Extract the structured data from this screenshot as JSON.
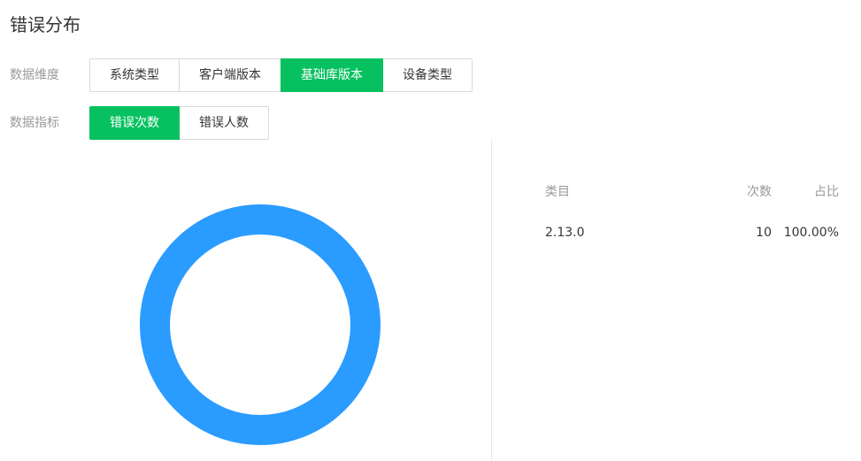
{
  "page": {
    "title": "错误分布"
  },
  "filters": {
    "dimension": {
      "label": "数据维度",
      "options": [
        {
          "label": "系统类型",
          "active": false
        },
        {
          "label": "客户端版本",
          "active": false
        },
        {
          "label": "基础库版本",
          "active": true
        },
        {
          "label": "设备类型",
          "active": false
        }
      ]
    },
    "metric": {
      "label": "数据指标",
      "options": [
        {
          "label": "错误次数",
          "active": true
        },
        {
          "label": "错误人数",
          "active": false
        }
      ]
    }
  },
  "colors": {
    "accent": "#07c160",
    "series": "#2a9bff"
  },
  "table": {
    "headers": {
      "category": "类目",
      "count": "次数",
      "ratio": "占比"
    },
    "rows": [
      {
        "category": "2.13.0",
        "count": "10",
        "ratio": "100.00%"
      }
    ]
  },
  "chart_data": {
    "type": "pie",
    "donut": true,
    "categories": [
      "2.13.0"
    ],
    "values": [
      10
    ],
    "colors": [
      "#2a9bff"
    ],
    "title": "",
    "legend": "none"
  }
}
